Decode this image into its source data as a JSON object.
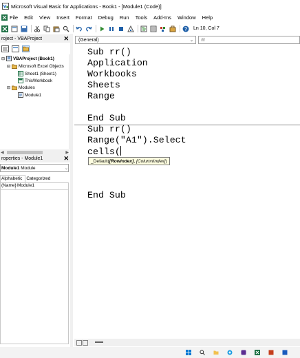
{
  "window": {
    "title": "Microsoft Visual Basic for Applications - Book1 - [Module1 (Code)]"
  },
  "menu": [
    {
      "label": "File"
    },
    {
      "label": "Edit"
    },
    {
      "label": "View"
    },
    {
      "label": "Insert"
    },
    {
      "label": "Format"
    },
    {
      "label": "Debug"
    },
    {
      "label": "Run"
    },
    {
      "label": "Tools"
    },
    {
      "label": "Add-Ins"
    },
    {
      "label": "Window"
    },
    {
      "label": "Help"
    }
  ],
  "toolbar": {
    "position": "Ln 10, Col 7"
  },
  "project_panel": {
    "title": "roject - VBAProject",
    "close_glyph": "✕",
    "tree": [
      {
        "label": "VBAProject (Book1)",
        "bold": true
      },
      {
        "label": "Microsoft Excel Objects"
      },
      {
        "label": "Sheet1 (Sheet1)"
      },
      {
        "label": "ThisWorkbook"
      },
      {
        "label": "Modules"
      },
      {
        "label": "Module1"
      }
    ]
  },
  "properties_panel": {
    "title": "roperties - Module1",
    "close_glyph": "✕",
    "object_name": "Module1",
    "object_type": "Module",
    "tabs": [
      {
        "label": "Alphabetic"
      },
      {
        "label": "Categorized"
      }
    ],
    "rows": [
      {
        "name": "(Name)",
        "value": "Module1"
      }
    ]
  },
  "code_window": {
    "object_dropdown": "(General)",
    "procedure_dropdown": "rr",
    "lines": [
      "Sub rr()",
      "Application",
      "Workbooks",
      "Sheets",
      "Range",
      "",
      "End Sub",
      "Sub rr()",
      "Range(\"A1\").Select",
      "cells(",
      "",
      "",
      "",
      "End Sub"
    ],
    "tooltip": {
      "prefix": "_Default(",
      "param1": "[RowIndex]",
      "separator": ", ",
      "param2": "[ColumnIndex]",
      "suffix": ")"
    }
  },
  "colors": {
    "chrome": "#f0f0f0",
    "tooltip_bg": "#ffffe1",
    "accent": "#0063b1"
  }
}
